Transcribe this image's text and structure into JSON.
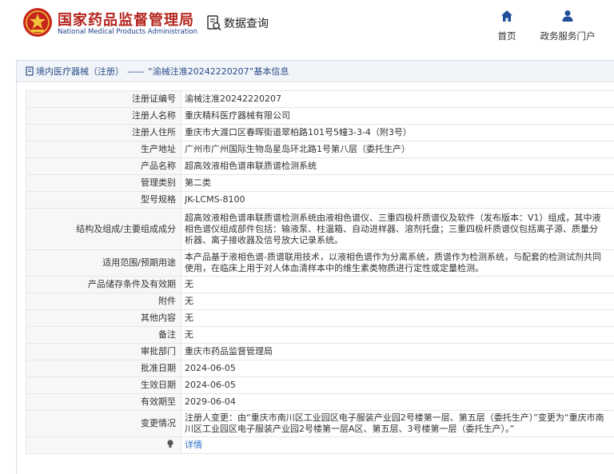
{
  "header": {
    "site_title": "国家药品监督管理局",
    "site_subtitle": "National Medical Products Administration",
    "section": "数据查询",
    "nav": [
      {
        "label": "首页",
        "icon": "home-icon"
      },
      {
        "label": "政务服务门户",
        "icon": "user-icon"
      }
    ]
  },
  "breadcrumb": {
    "part1": "境内医疗器械（注册）",
    "separator": "——",
    "part2": "“渝械注准20242220207”基本信息"
  },
  "record": [
    {
      "label": "注册证编号",
      "value": "渝械注准20242220207"
    },
    {
      "label": "注册人名称",
      "value": "重庆精科医疗器械有限公司"
    },
    {
      "label": "注册人住所",
      "value": "重庆市大渡口区春晖街道翠柏路101号5幢3-3-4（附3号）"
    },
    {
      "label": "生产地址",
      "value": "广州市广州国际生物岛星岛环北路1号第八层（委托生产）"
    },
    {
      "label": "产品名称",
      "value": "超高效液相色谱串联质谱检测系统"
    },
    {
      "label": "管理类别",
      "value": "第二类"
    },
    {
      "label": "型号规格",
      "value": "JK-LCMS-8100"
    },
    {
      "label": "结构及组成/主要组成成分",
      "value": "超高效液相色谱串联质谱检测系统由液相色谱仪、三重四极杆质谱仪及软件（发布版本：V1）组成，其中液相色谱仪组成部件包括：输液泵、柱温箱、自动进样器、溶剂托盘；三重四极杆质谱仪包括离子源、质量分析器、离子接收器及信号放大记录系统。"
    },
    {
      "label": "适用范围/预期用途",
      "value": "本产品基于液相色谱-质谱联用技术，以液相色谱作为分离系统，质谱作为检测系统，与配套的检测试剂共同使用，在临床上用于对人体血清样本中的维生素类物质进行定性或定量检测。"
    },
    {
      "label": "产品储存条件及有效期",
      "value": "无"
    },
    {
      "label": "附件",
      "value": "无"
    },
    {
      "label": "其他内容",
      "value": "无"
    },
    {
      "label": "备注",
      "value": "无"
    },
    {
      "label": "审批部门",
      "value": "重庆市药品监督管理局"
    },
    {
      "label": "批准日期",
      "value": "2024-06-05"
    },
    {
      "label": "生效日期",
      "value": "2024-06-05"
    },
    {
      "label": "有效期至",
      "value": "2029-06-04"
    },
    {
      "label": "变更情况",
      "value": "注册人变更：由“重庆市南川区工业园区电子服装产业园2号楼第一层、第五层（委托生产）”变更为“重庆市南川区工业园区电子服装产业园2号楼第一层A区、第五层、3号楼第一层（委托生产）。”"
    }
  ],
  "details": {
    "icon": "info-pin-icon",
    "link": "详情"
  },
  "colors": {
    "brand_red": "#b5261f",
    "brand_blue": "#1f3f8a",
    "link": "#2a6fc6",
    "title_text": "#2b4f8a"
  }
}
